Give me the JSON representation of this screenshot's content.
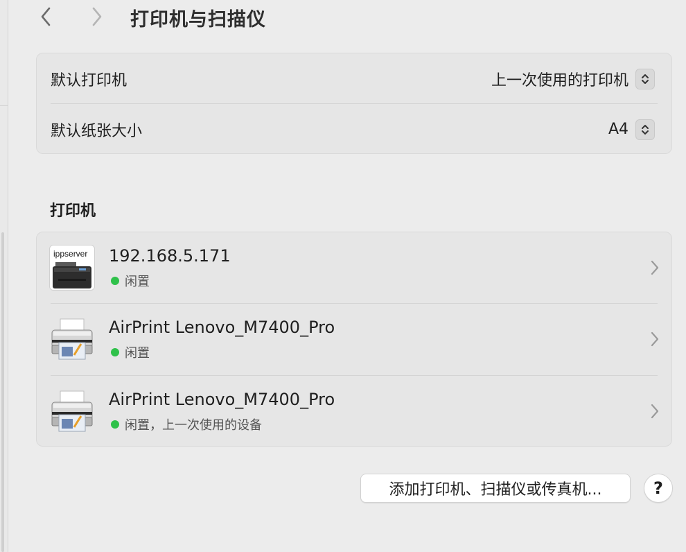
{
  "toolbar": {
    "title": "打印机与扫描仪",
    "back_icon": "chevron-left-icon",
    "forward_icon": "chevron-right-icon"
  },
  "defaults": {
    "printer_label": "默认打印机",
    "printer_value": "上一次使用的打印机",
    "paper_label": "默认纸张大小",
    "paper_value": "A4"
  },
  "printers_section": {
    "title": "打印机",
    "items": [
      {
        "name": "192.168.5.171",
        "status": "闲置",
        "icon": "ippserver-printer-icon",
        "icon_text": "ippserver"
      },
      {
        "name": "AirPrint Lenovo_M7400_Pro",
        "status": "闲置",
        "icon": "printer-icon"
      },
      {
        "name": "AirPrint Lenovo_M7400_Pro",
        "status": "闲置，上一次使用的设备",
        "icon": "printer-icon"
      }
    ]
  },
  "footer": {
    "add_button_label": "添加打印机、扫描仪或传真机...",
    "help_label": "?"
  },
  "colors": {
    "background": "#ececec",
    "group_background": "#e6e6e6",
    "status_green": "#2fc14a"
  }
}
